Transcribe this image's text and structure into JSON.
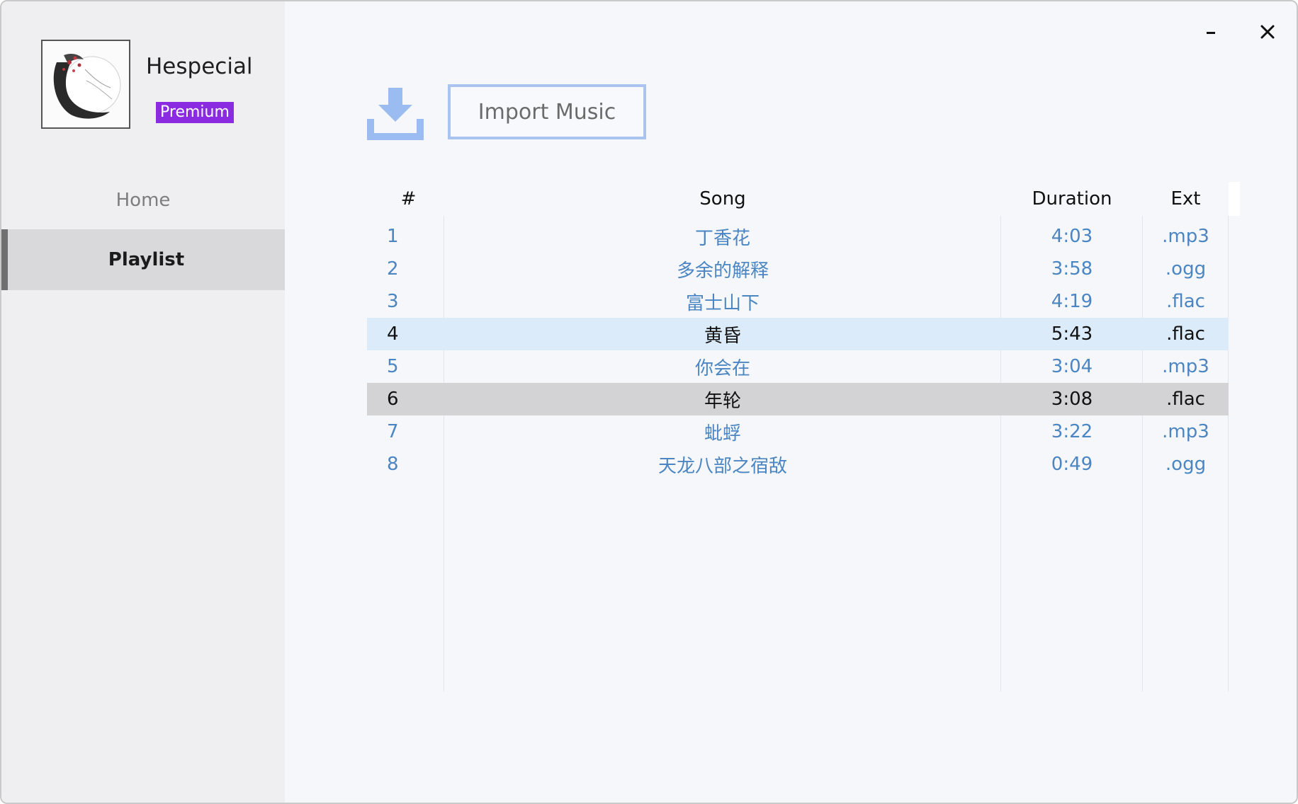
{
  "window": {
    "controls": {
      "minimize": "-",
      "close": "✕"
    }
  },
  "profile": {
    "username": "Hespecial",
    "badge": "Premium",
    "badge_color": "#8a2be2"
  },
  "nav": {
    "items": [
      {
        "label": "Home",
        "active": false
      },
      {
        "label": "Playlist",
        "active": true
      }
    ]
  },
  "toolbar": {
    "import_icon": "download-icon",
    "import_label": "Import Music"
  },
  "table": {
    "headers": {
      "num": "#",
      "song": "Song",
      "duration": "Duration",
      "ext": "Ext"
    },
    "rows": [
      {
        "num": "1",
        "song": "丁香花",
        "duration": "4:03",
        "ext": ".mp3",
        "state": "normal"
      },
      {
        "num": "2",
        "song": "多余的解释",
        "duration": "3:58",
        "ext": ".ogg",
        "state": "normal"
      },
      {
        "num": "3",
        "song": "富士山下",
        "duration": "4:19",
        "ext": ".flac",
        "state": "normal"
      },
      {
        "num": "4",
        "song": "黄昏",
        "duration": "5:43",
        "ext": ".flac",
        "state": "hover"
      },
      {
        "num": "5",
        "song": "你会在",
        "duration": "3:04",
        "ext": ".mp3",
        "state": "normal"
      },
      {
        "num": "6",
        "song": "年轮",
        "duration": "3:08",
        "ext": ".flac",
        "state": "selected"
      },
      {
        "num": "7",
        "song": "蚍蜉",
        "duration": "3:22",
        "ext": ".mp3",
        "state": "normal"
      },
      {
        "num": "8",
        "song": "天龙八部之宿敌",
        "duration": "0:49",
        "ext": ".ogg",
        "state": "normal"
      }
    ]
  },
  "colors": {
    "accent_link": "#4b86c2",
    "hover_row": "#dcebfa",
    "selected_row": "#d3d3d5",
    "import_border": "#a9c4ee",
    "import_icon": "#9bbcf0"
  }
}
